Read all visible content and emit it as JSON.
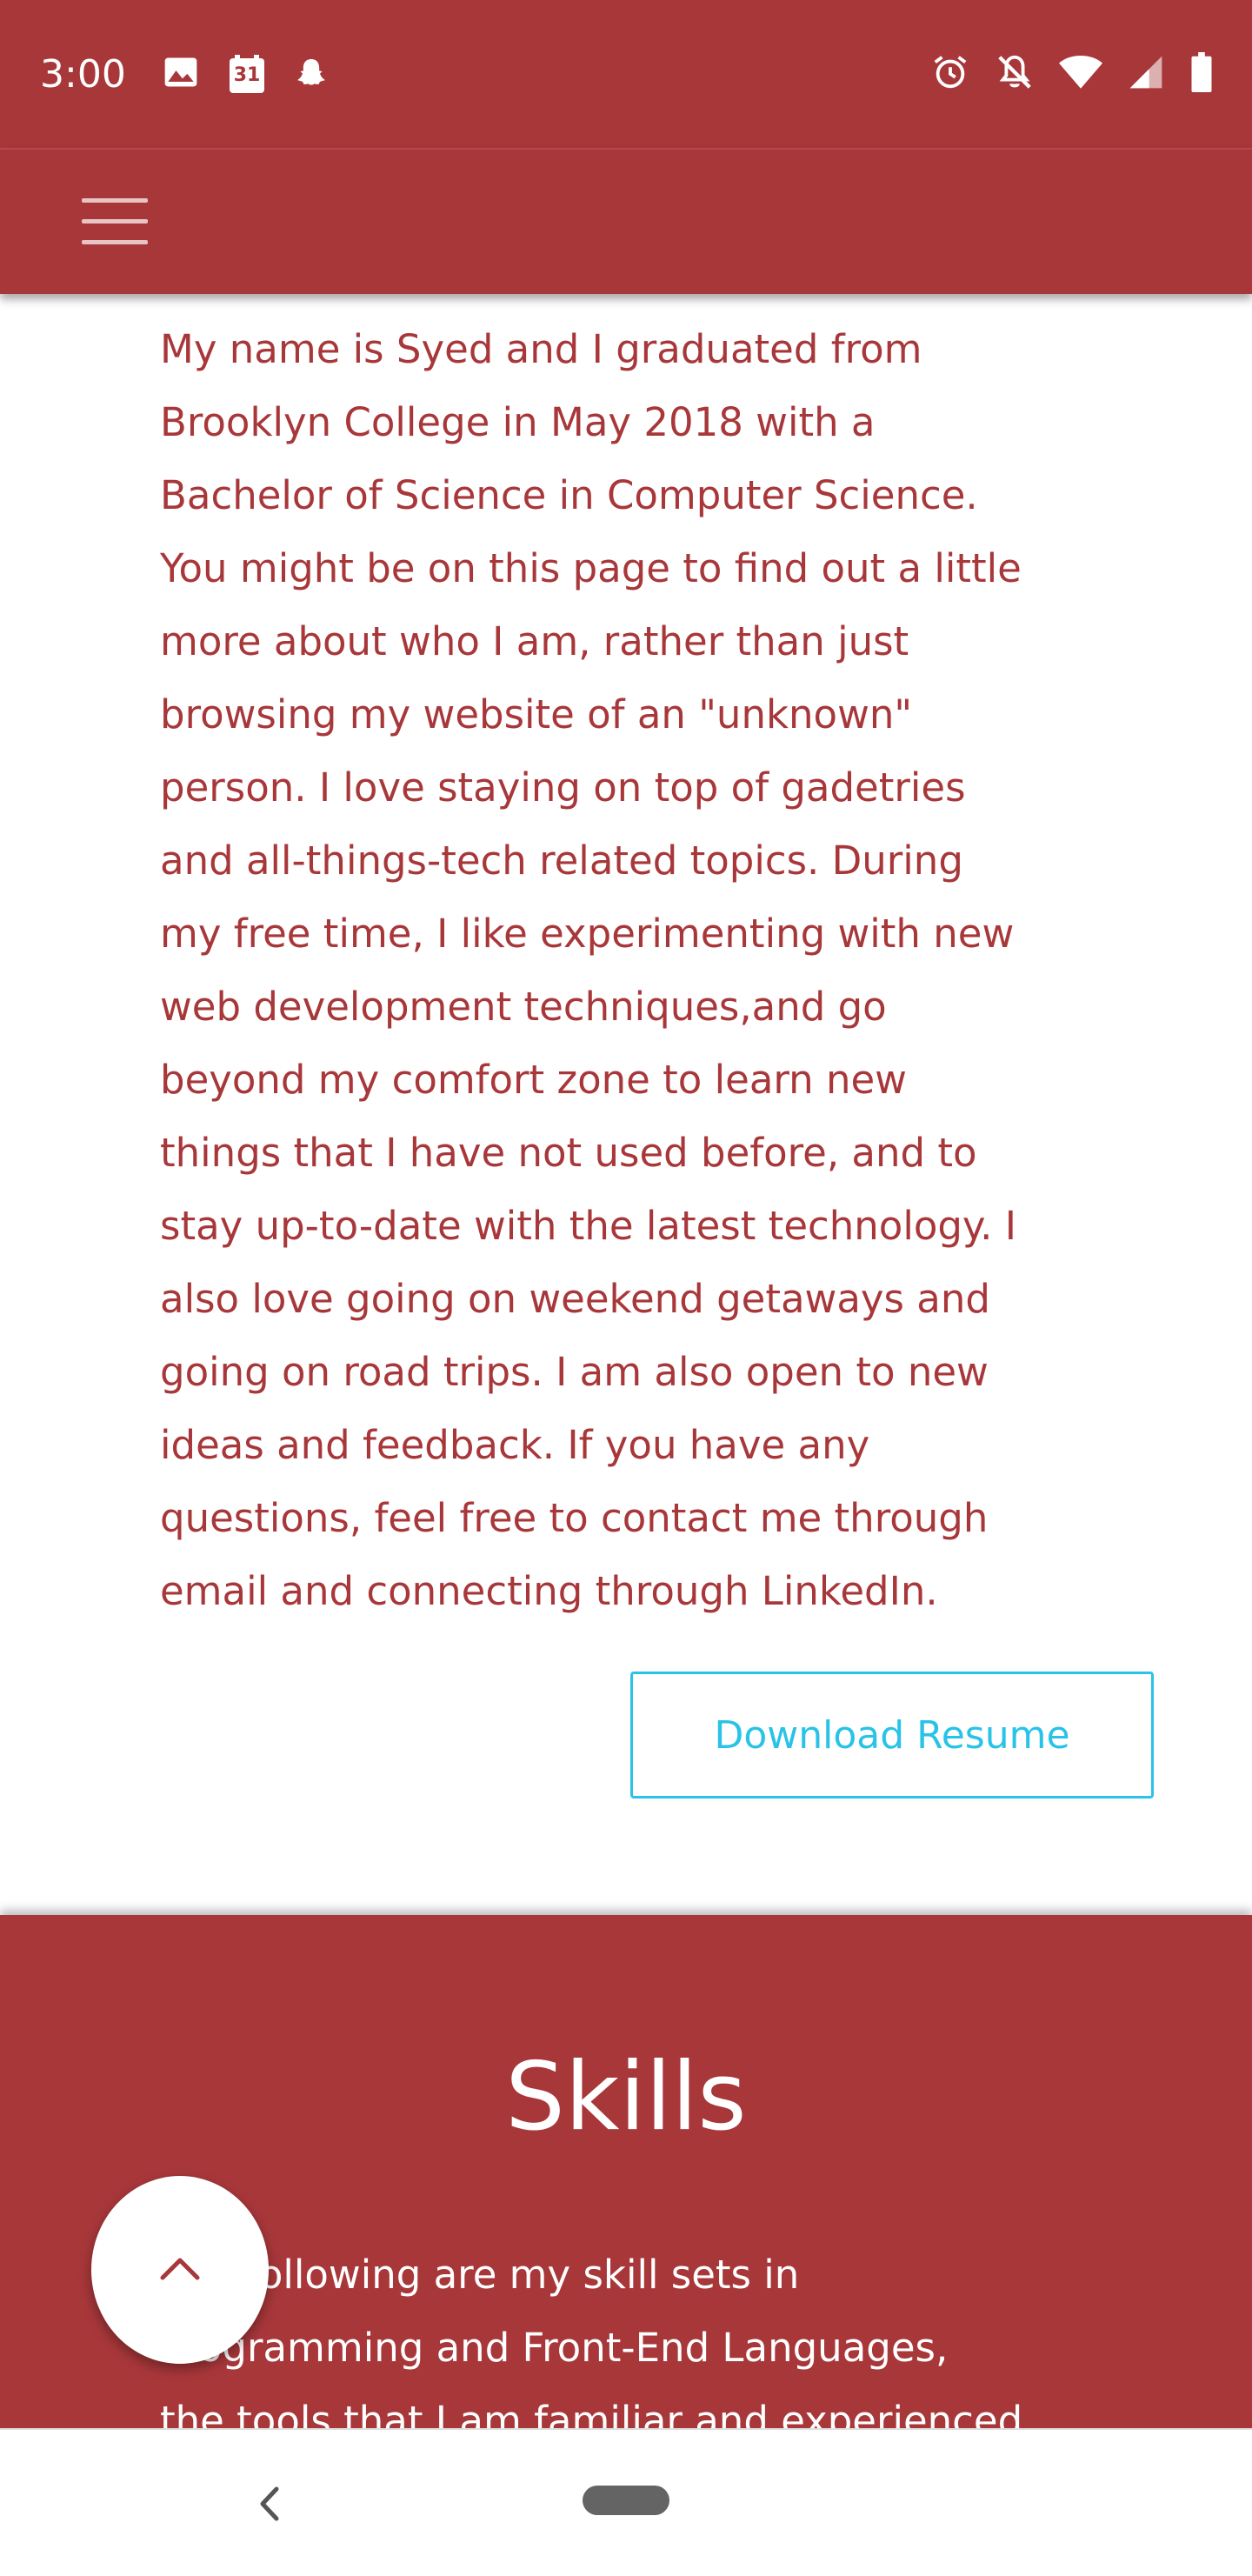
{
  "status_bar": {
    "time": "3:00",
    "calendar_day": "31",
    "left_icons": [
      "image-icon",
      "calendar-icon",
      "snapchat-icon"
    ],
    "right_icons": [
      "alarm-icon",
      "bell-off-icon",
      "wifi-icon",
      "signal-icon",
      "battery-icon"
    ]
  },
  "navbar": {
    "menu_icon": "hamburger-menu-icon",
    "background_color": "#a8373a"
  },
  "about": {
    "paragraph": "My name is Syed and I graduated from\nBrooklyn College in May 2018 with a\nBachelor of Science in Computer Science.\nYou might be on this page to find out a little\nmore about who I am, rather than just\nbrowsing my website of an \"unknown\"\nperson. I love staying on top of gadetries\nand all-things-tech related topics. During\nmy free time, I like experimenting with new\nweb development techniques,and go\nbeyond my comfort zone to learn new\nthings that I have not used before, and to\nstay up-to-date with the latest technology. I\nalso love going on weekend getaways and\ngoing on road trips. I am also open to new\nideas and feedback. If you have any\nquestions, feel free to contact me through\nemail and connecting through LinkedIn.",
    "text_color": "#a8373a",
    "resume_button_label": "Download Resume",
    "resume_button_color": "#29c3e8"
  },
  "skills": {
    "title": "Skills",
    "intro": "The following are my skill sets in\nProgramming and Front-End Languages,\nthe tools that I am familiar and experienced",
    "background_color": "#a8373a"
  },
  "scroll_top_button": {
    "icon": "chevron-up-icon"
  },
  "system_nav": {
    "back_icon": "back-chevron-icon",
    "home_icon": "home-pill-icon"
  }
}
